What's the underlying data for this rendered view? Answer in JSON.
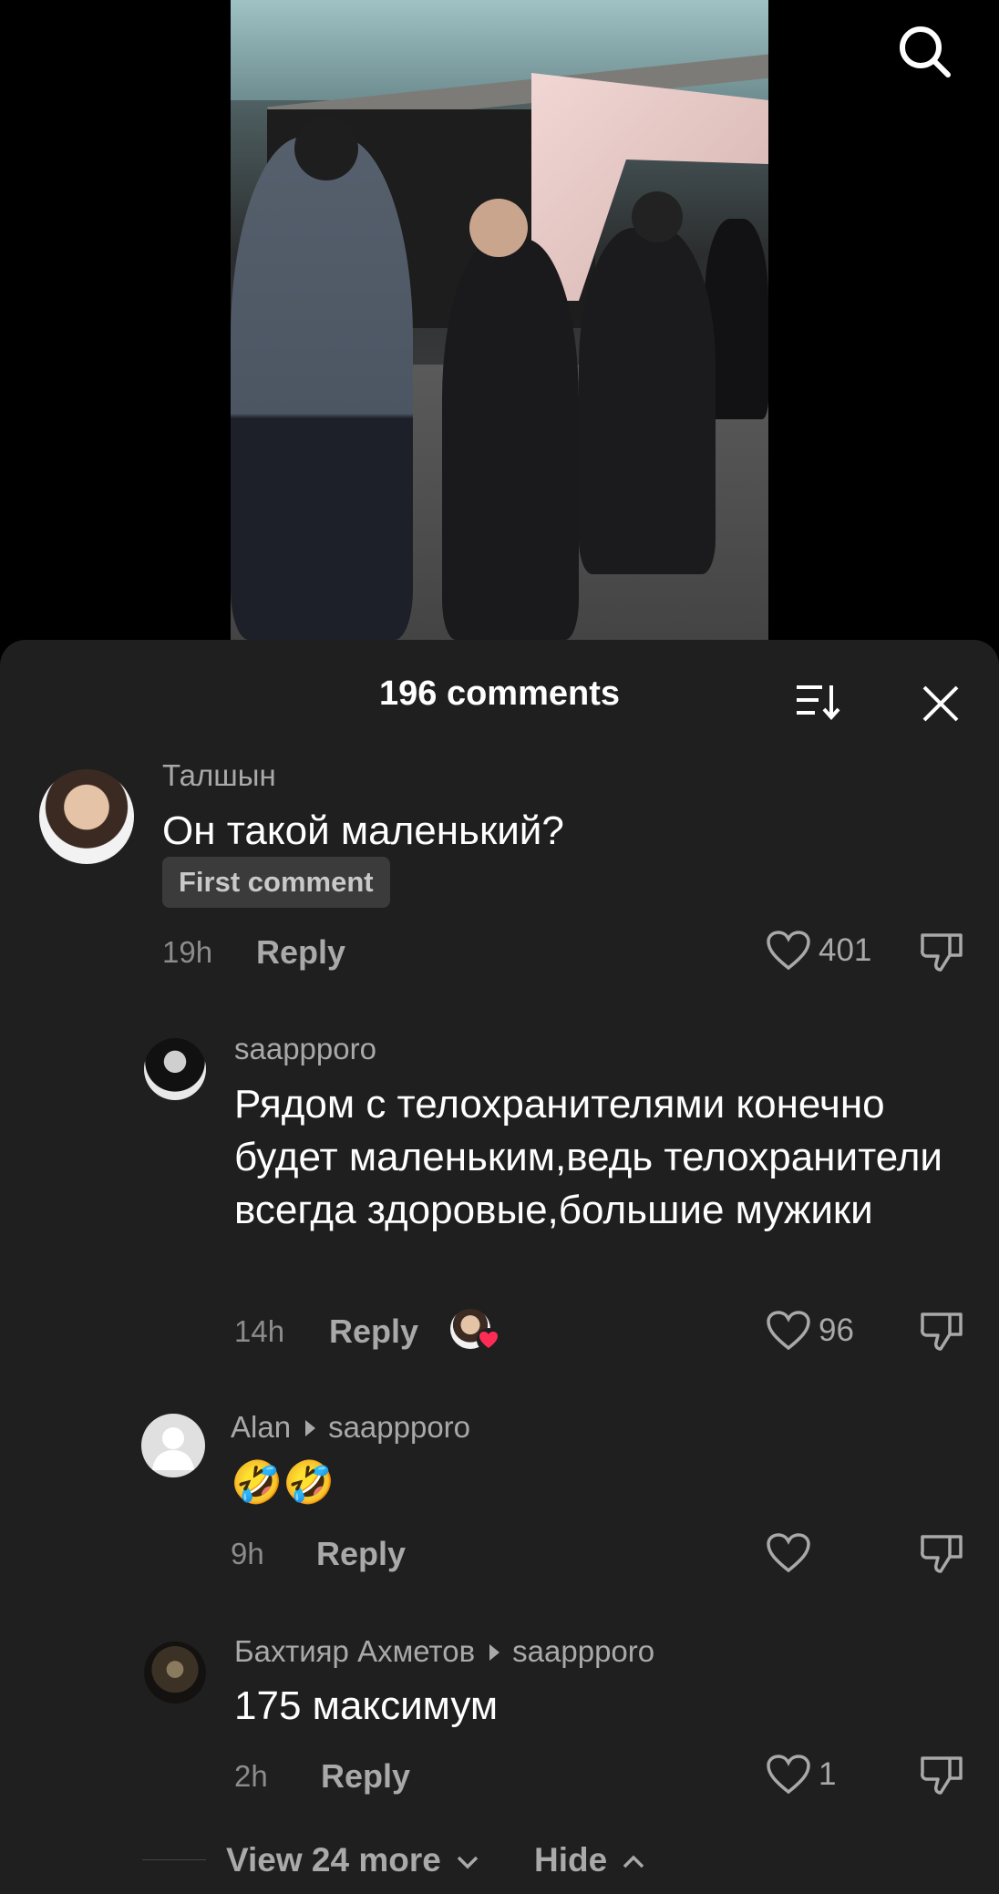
{
  "sheet": {
    "title": "196 comments"
  },
  "comments": [
    {
      "username": "Талшын",
      "text": "Он такой маленький?",
      "badge": "First comment",
      "time": "19h",
      "reply_label": "Reply",
      "likes": "401"
    },
    {
      "username": "saappporo",
      "text": "Рядом с телохранителями конечно будет маленьким,ведь телохранители всегда здоровые,большие мужики",
      "time": "14h",
      "reply_label": "Reply",
      "likes": "96"
    },
    {
      "username": "Alan",
      "reply_to": "saappporo",
      "text": "🤣🤣",
      "time": "9h",
      "reply_label": "Reply",
      "likes": ""
    },
    {
      "username": "Бахтияр Ахметов",
      "reply_to": "saappporo",
      "text": "175 максимум",
      "time": "2h",
      "reply_label": "Reply",
      "likes": "1"
    }
  ],
  "footer": {
    "view_more": "View 24 more",
    "hide": "Hide"
  },
  "colors": {
    "sheet_bg": "#1f1f1f",
    "muted_text": "#a9a9a9",
    "heart_badge": "#fe2c55"
  }
}
